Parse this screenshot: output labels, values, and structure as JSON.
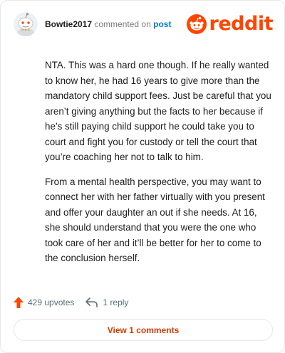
{
  "comment": {
    "username": "Bowtie2017",
    "action_text": "commented on",
    "post_link": "post",
    "paragraphs": [
      "NTA. This was a hard one though. If he really wanted to know her, he had 16 years to give more than the mandatory child support fees. Just be careful that you aren’t giving anything but the facts to her because if he’s still paying child support he could take you to court and fight you for custody or tell the court that you’re coaching her not to talk to him.",
      "From a mental health perspective, you may want to connect her with her father virtually with you present and offer your daughter an out if she needs. At 16, she should understand that you were the one who took care of her and it’ll be better for her to come to the conclusion herself."
    ]
  },
  "brand": {
    "wordmark": "reddit",
    "color": "#ff4500"
  },
  "stats": {
    "upvotes": "429 upvotes",
    "replies": "1 reply"
  },
  "view_button": {
    "label": "View 1 comments"
  },
  "icons": {
    "avatar": "snoo-avatar-icon",
    "logo": "reddit-snoo-icon",
    "upvote": "upvote-arrow-icon",
    "reply": "reply-arrow-icon"
  },
  "colors": {
    "accent": "#ff4500",
    "link": "#0079d3",
    "view_button_text": "#d93a00",
    "muted": "#576f76"
  }
}
